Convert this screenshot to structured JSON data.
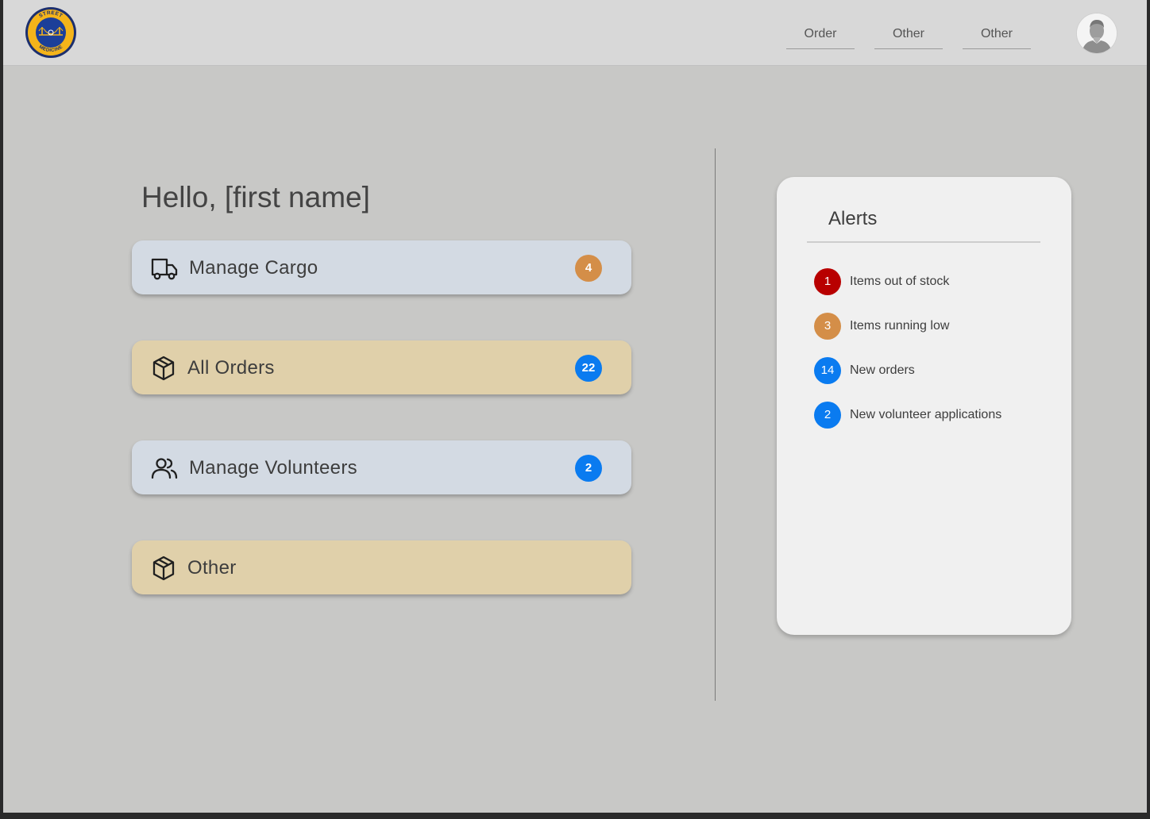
{
  "header": {
    "logo_top_text": "STREET",
    "logo_bottom_text": "MEDICINE",
    "nav": [
      {
        "label": "Order"
      },
      {
        "label": "Other"
      },
      {
        "label": "Other"
      }
    ],
    "avatar_icon": "user-avatar-icon"
  },
  "main": {
    "greeting": "Hello, [first name]",
    "cards": [
      {
        "label": "Manage Cargo",
        "icon": "truck-icon",
        "badge": "4",
        "badge_color": "#d48e48",
        "bg": "#d3dae3"
      },
      {
        "label": "All Orders",
        "icon": "box-icon",
        "badge": "22",
        "badge_color": "#0a7bf0",
        "bg": "#e0d0aa"
      },
      {
        "label": "Manage Volunteers",
        "icon": "users-icon",
        "badge": "2",
        "badge_color": "#0a7bf0",
        "bg": "#d3dae3"
      },
      {
        "label": "Other",
        "icon": "box-icon",
        "bg": "#e0d0aa"
      }
    ]
  },
  "alerts": {
    "title": "Alerts",
    "items": [
      {
        "count": "1",
        "text": "Items out of stock",
        "color": "#b80000"
      },
      {
        "count": "3",
        "text": "Items running low",
        "color": "#d48e48"
      },
      {
        "count": "14",
        "text": "New orders",
        "color": "#0a7bf0"
      },
      {
        "count": "2",
        "text": "New volunteer applications",
        "color": "#0a7bf0"
      }
    ]
  }
}
